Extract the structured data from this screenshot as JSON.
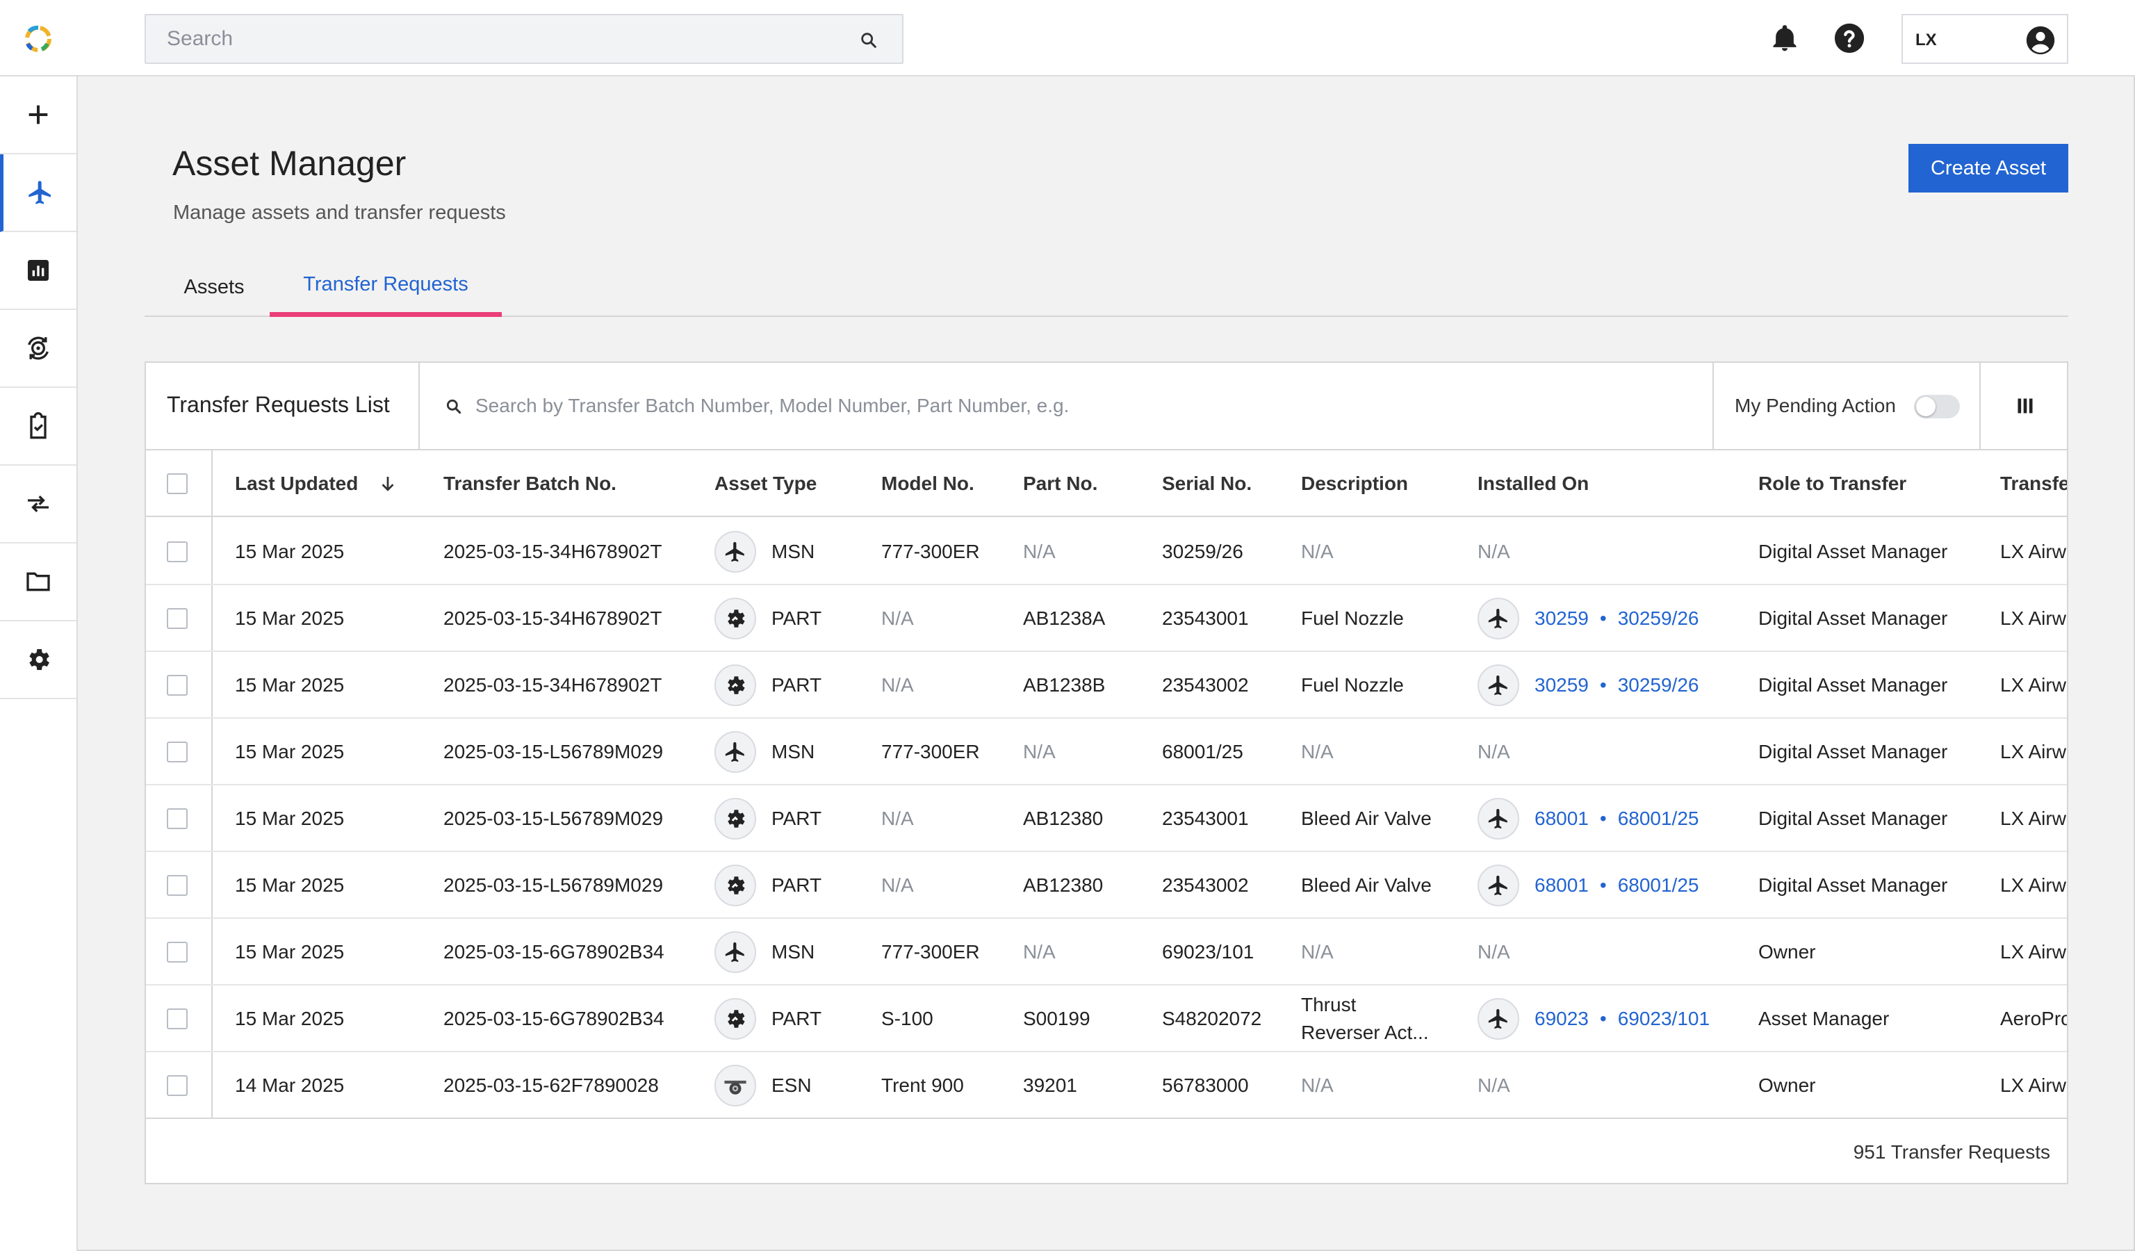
{
  "header": {
    "search_placeholder": "Search",
    "user_initials": "LX"
  },
  "sidebar": {
    "items": [
      {
        "name": "add",
        "icon": "plus-icon"
      },
      {
        "name": "assets",
        "icon": "airplane-icon",
        "active": true
      },
      {
        "name": "reports",
        "icon": "bar-chart-icon"
      },
      {
        "name": "transfers",
        "icon": "engine-rotate-icon"
      },
      {
        "name": "tasks",
        "icon": "clipboard-check-icon"
      },
      {
        "name": "exchange",
        "icon": "swap-arrows-icon"
      },
      {
        "name": "files",
        "icon": "folder-icon"
      },
      {
        "name": "settings",
        "icon": "gear-icon"
      }
    ]
  },
  "page": {
    "title": "Asset Manager",
    "subtitle": "Manage assets and transfer requests",
    "create_button": "Create Asset",
    "tabs": [
      {
        "label": "Assets",
        "active": false
      },
      {
        "label": "Transfer Requests",
        "active": true
      }
    ]
  },
  "list": {
    "title": "Transfer Requests List",
    "search_placeholder": "Search by Transfer Batch Number, Model Number, Part Number, e.g.",
    "pending_label": "My Pending Action",
    "pending_on": false,
    "columns": [
      "Last Updated",
      "Transfer Batch No.",
      "Asset Type",
      "Model No.",
      "Part No.",
      "Serial No.",
      "Description",
      "Installed On",
      "Role to Transfer",
      "Transfe"
    ],
    "sort_column": "Last Updated",
    "sort_direction": "descending",
    "rows": [
      {
        "updated": "15 Mar 2025",
        "batch": "2025-03-15-34H678902T",
        "type_icon": "airplane-icon",
        "type": "MSN",
        "model": "777-300ER",
        "part": "N/A",
        "serial": "30259/26",
        "desc": "N/A",
        "inst_a": "",
        "inst_b": "",
        "inst_text": "N/A",
        "role": "Digital Asset Manager",
        "to": "LX Airw"
      },
      {
        "updated": "15 Mar 2025",
        "batch": "2025-03-15-34H678902T",
        "type_icon": "part-gear-icon",
        "type": "PART",
        "model": "N/A",
        "part": "AB1238A",
        "serial": "23543001",
        "desc": "Fuel Nozzle",
        "inst_a": "30259",
        "inst_b": "30259/26",
        "inst_text": "",
        "role": "Digital Asset Manager",
        "to": "LX Airw"
      },
      {
        "updated": "15 Mar 2025",
        "batch": "2025-03-15-34H678902T",
        "type_icon": "part-gear-icon",
        "type": "PART",
        "model": "N/A",
        "part": "AB1238B",
        "serial": "23543002",
        "desc": "Fuel Nozzle",
        "inst_a": "30259",
        "inst_b": "30259/26",
        "inst_text": "",
        "role": "Digital Asset Manager",
        "to": "LX Airw"
      },
      {
        "updated": "15 Mar 2025",
        "batch": "2025-03-15-L56789M029",
        "type_icon": "airplane-icon",
        "type": "MSN",
        "model": "777-300ER",
        "part": "N/A",
        "serial": "68001/25",
        "desc": "N/A",
        "inst_a": "",
        "inst_b": "",
        "inst_text": "N/A",
        "role": "Digital Asset Manager",
        "to": "LX Airw"
      },
      {
        "updated": "15 Mar 2025",
        "batch": "2025-03-15-L56789M029",
        "type_icon": "part-gear-icon",
        "type": "PART",
        "model": "N/A",
        "part": "AB12380",
        "serial": "23543001",
        "desc": "Bleed Air Valve",
        "inst_a": "68001",
        "inst_b": "68001/25",
        "inst_text": "",
        "role": "Digital Asset Manager",
        "to": "LX Airw"
      },
      {
        "updated": "15 Mar 2025",
        "batch": "2025-03-15-L56789M029",
        "type_icon": "part-gear-icon",
        "type": "PART",
        "model": "N/A",
        "part": "AB12380",
        "serial": "23543002",
        "desc": "Bleed Air Valve",
        "inst_a": "68001",
        "inst_b": "68001/25",
        "inst_text": "",
        "role": "Digital Asset Manager",
        "to": "LX Airw"
      },
      {
        "updated": "15 Mar 2025",
        "batch": "2025-03-15-6G78902B34",
        "type_icon": "airplane-icon",
        "type": "MSN",
        "model": "777-300ER",
        "part": "N/A",
        "serial": "69023/101",
        "desc": "N/A",
        "inst_a": "",
        "inst_b": "",
        "inst_text": "N/A",
        "role": "Owner",
        "to": "LX Airw"
      },
      {
        "updated": "15 Mar 2025",
        "batch": "2025-03-15-6G78902B34",
        "type_icon": "part-gear-icon",
        "type": "PART",
        "model": "S-100",
        "part": "S00199",
        "serial": "S48202072",
        "desc": "Thrust Reverser Act...",
        "inst_a": "69023",
        "inst_b": "69023/101",
        "inst_text": "",
        "role": "Asset Manager",
        "to": "AeroPro"
      },
      {
        "updated": "14 Mar 2025",
        "batch": "2025-03-15-62F7890028",
        "type_icon": "engine-icon",
        "type": "ESN",
        "model": "Trent 900",
        "part": "39201",
        "serial": "56783000",
        "desc": "N/A",
        "inst_a": "",
        "inst_b": "",
        "inst_text": "N/A",
        "role": "Owner",
        "to": "LX Airw"
      }
    ],
    "total": "951 Transfer Requests"
  },
  "colors": {
    "accent": "#2264d1",
    "tab_underline": "#ea3f78",
    "muted_text": "#8a8f98"
  }
}
